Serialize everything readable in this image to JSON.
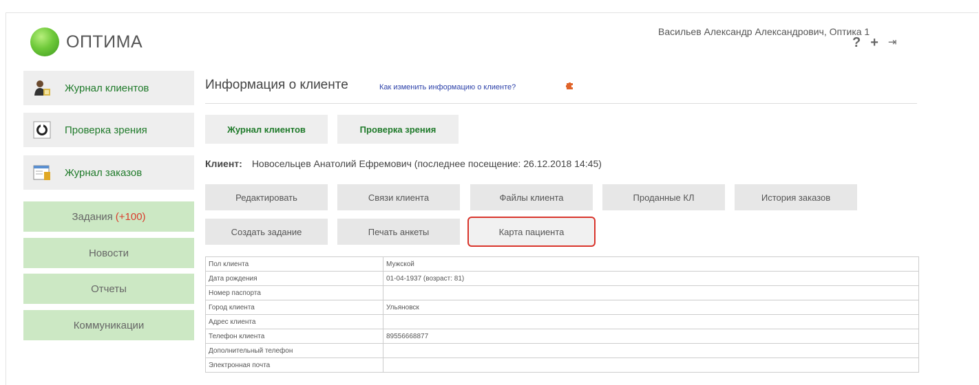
{
  "app": {
    "name": "ОПТИМА"
  },
  "user": {
    "name": "Васильев Александр Александрович, Оптика 1"
  },
  "header_icons": [
    {
      "name": "help-icon",
      "glyph": "?"
    },
    {
      "name": "plus-icon",
      "glyph": "+"
    },
    {
      "name": "logout-icon",
      "glyph": "⇥"
    }
  ],
  "sidebar": {
    "items": [
      {
        "label": "Журнал клиентов",
        "icon": "client-journal-icon"
      },
      {
        "label": "Проверка зрения",
        "icon": "vision-check-icon"
      },
      {
        "label": "Журнал заказов",
        "icon": "order-journal-icon"
      }
    ],
    "green_items": [
      {
        "label": "Задания",
        "badge": "(+100)"
      },
      {
        "label": "Новости"
      },
      {
        "label": "Отчеты"
      },
      {
        "label": "Коммуникации"
      }
    ]
  },
  "main": {
    "title": "Информация о клиенте",
    "help_link": "Как изменить информацию о клиенте?",
    "nav_buttons": [
      "Журнал клиентов",
      "Проверка зрения"
    ],
    "client_label": "Клиент:",
    "client_value": "Новосельцев Анатолий Ефремович (последнее посещение: 26.12.2018 14:45)",
    "action_buttons_row1": [
      "Редактировать",
      "Связи клиента",
      "Файлы клиента",
      "Проданные КЛ",
      "История заказов"
    ],
    "action_buttons_row2": [
      "Создать задание",
      "Печать анкеты",
      "Карта пациента"
    ],
    "table": [
      {
        "label": "Пол клиента",
        "value": "Мужской"
      },
      {
        "label": "Дата рождения",
        "value": "01-04-1937 (возраст: 81)"
      },
      {
        "label": "Номер паспорта",
        "value": ""
      },
      {
        "label": "Город клиента",
        "value": "Ульяновск"
      },
      {
        "label": "Адрес клиента",
        "value": ""
      },
      {
        "label": "Телефон клиента",
        "value": "89556668877"
      },
      {
        "label": "Дополнительный телефон",
        "value": ""
      },
      {
        "label": "Электронная почта",
        "value": ""
      }
    ]
  },
  "colors": {
    "green_text": "#1f7a2a",
    "green_button": "#cce8c4",
    "badge_red": "#d93b2b",
    "highlight_border": "#d9342b",
    "link_blue": "#2a3fa8"
  }
}
